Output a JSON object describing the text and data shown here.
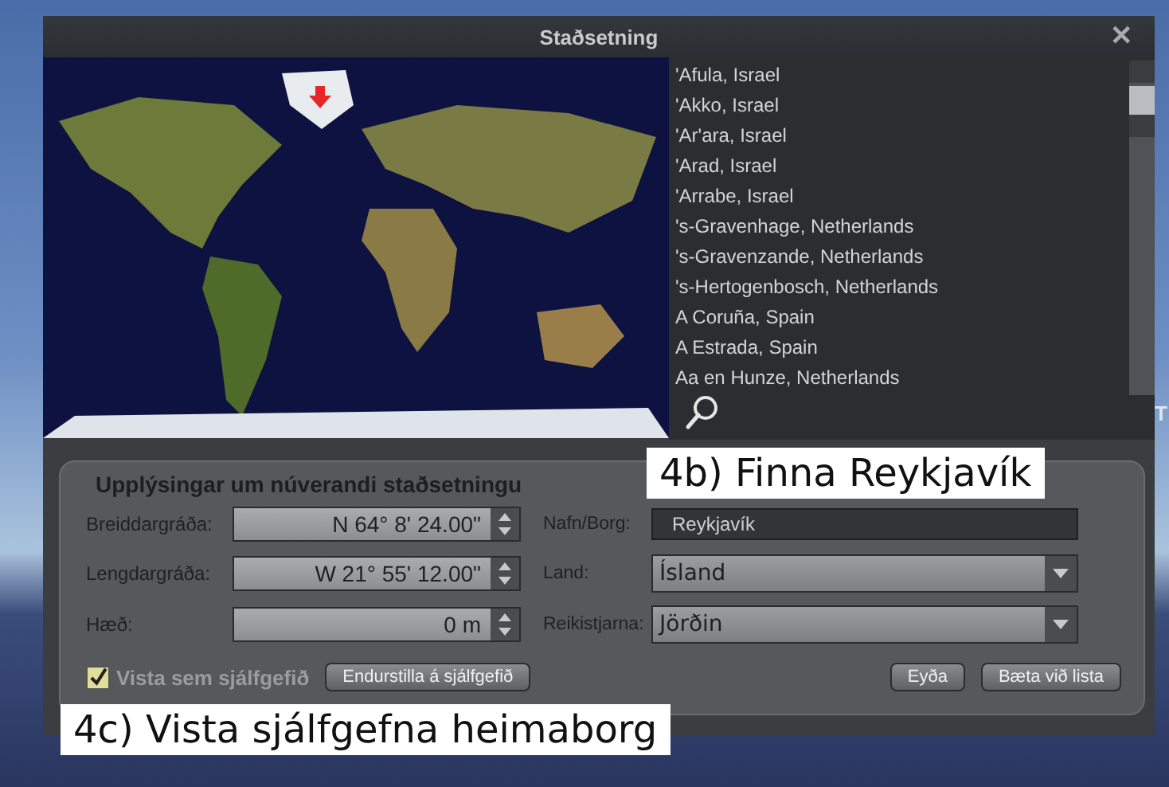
{
  "window": {
    "title": "Staðsetning",
    "close": "✕"
  },
  "background_text": "T",
  "location_list": {
    "items": [
      {
        "text": "'Afula, Israel"
      },
      {
        "text": "'Akko, Israel"
      },
      {
        "text": "'Ar'ara, Israel"
      },
      {
        "text": "'Arad, Israel"
      },
      {
        "text": "'Arrabe, Israel"
      },
      {
        "text": "'s-Gravenhage, Netherlands"
      },
      {
        "text": "'s-Gravenzande, Netherlands"
      },
      {
        "text": "'s-Hertogenbosch, Netherlands"
      },
      {
        "text": "A Coruña, Spain"
      },
      {
        "text": "A Estrada, Spain"
      },
      {
        "text": "Aa en Hunze, Netherlands"
      }
    ]
  },
  "info_panel": {
    "heading": "Upplýsingar um núverandi staðsetningu",
    "coordinates": [
      {
        "label": "Breiddargráða:",
        "value": "N 64° 8' 24.00\""
      },
      {
        "label": "Lengdargráða:",
        "value": "W 21° 55' 12.00\""
      },
      {
        "label": "Hæð:",
        "value": "0 m"
      }
    ],
    "details": [
      {
        "kind": "text",
        "label": "Nafn/Borg:",
        "value": "Reykjavík"
      },
      {
        "kind": "dropdown",
        "label": "Land:",
        "value": "Ísland"
      },
      {
        "kind": "dropdown",
        "label": "Reikistjarna:",
        "value": "Jörðin"
      }
    ],
    "default_checkbox": {
      "label": "Vista sem sjálfgefið",
      "checked": true
    },
    "reset_button": "Endurstilla á sjálfgefið",
    "buttons": [
      "Eyða",
      "Bæta við lista"
    ]
  },
  "annotations": [
    {
      "kind": "top",
      "text": "4b) Finna Reykjavík"
    },
    {
      "kind": "bottom",
      "text": "4c) Vista sjálfgefna heimaborg"
    }
  ]
}
